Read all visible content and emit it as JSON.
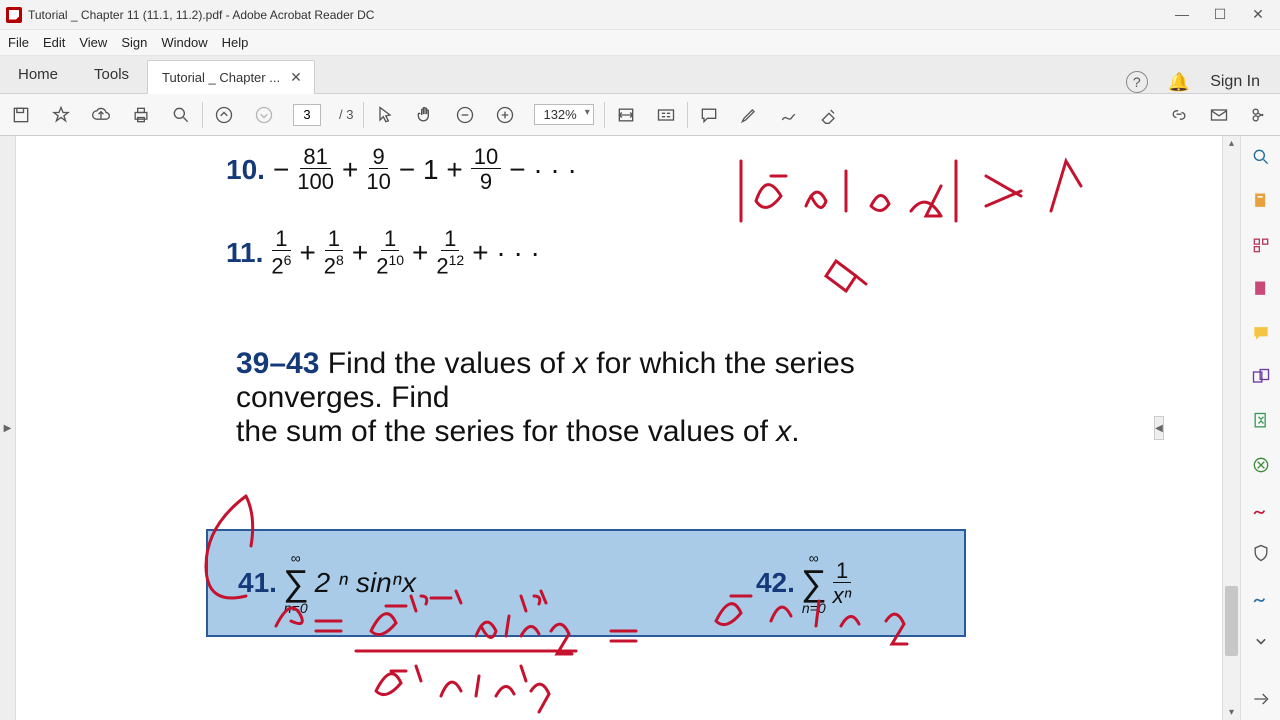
{
  "window": {
    "title": "Tutorial _ Chapter 11 (11.1, 11.2).pdf - Adobe Acrobat Reader DC"
  },
  "menu": {
    "file": "File",
    "edit": "Edit",
    "view": "View",
    "sign": "Sign",
    "window": "Window",
    "help": "Help"
  },
  "tabs": {
    "home": "Home",
    "tools": "Tools",
    "doc": "Tutorial _ Chapter ..."
  },
  "header_right": {
    "signin": "Sign In"
  },
  "toolbar": {
    "page_current": "3",
    "page_total": "/ 3",
    "zoom": "132%"
  },
  "document": {
    "p10": {
      "num": "10.",
      "expr_parts": [
        "−",
        "81",
        "100",
        " + ",
        "9",
        "10",
        " − 1 + ",
        "10",
        "9",
        " − · · ·"
      ]
    },
    "p11": {
      "num": "11.",
      "bases": [
        "2",
        "2",
        "2",
        "2"
      ],
      "exps": [
        "6",
        "8",
        "10",
        "12"
      ],
      "plus": " + ",
      "tail": " + · · ·"
    },
    "section": {
      "range": "39–43",
      "text1": "  Find the values of ",
      "var": "x",
      "text2": " for which the series converges. Find",
      "line2a": "the sum of the series for those values of ",
      "line2b": "x",
      "line2c": "."
    },
    "p41": {
      "num": "41.",
      "lower": "n=0",
      "upper": "∞",
      "body": "2 ⁿ sinⁿx"
    },
    "p42": {
      "num": "42.",
      "lower": "n=0",
      "upper": "∞",
      "top": "1",
      "bot": "xⁿ"
    }
  }
}
